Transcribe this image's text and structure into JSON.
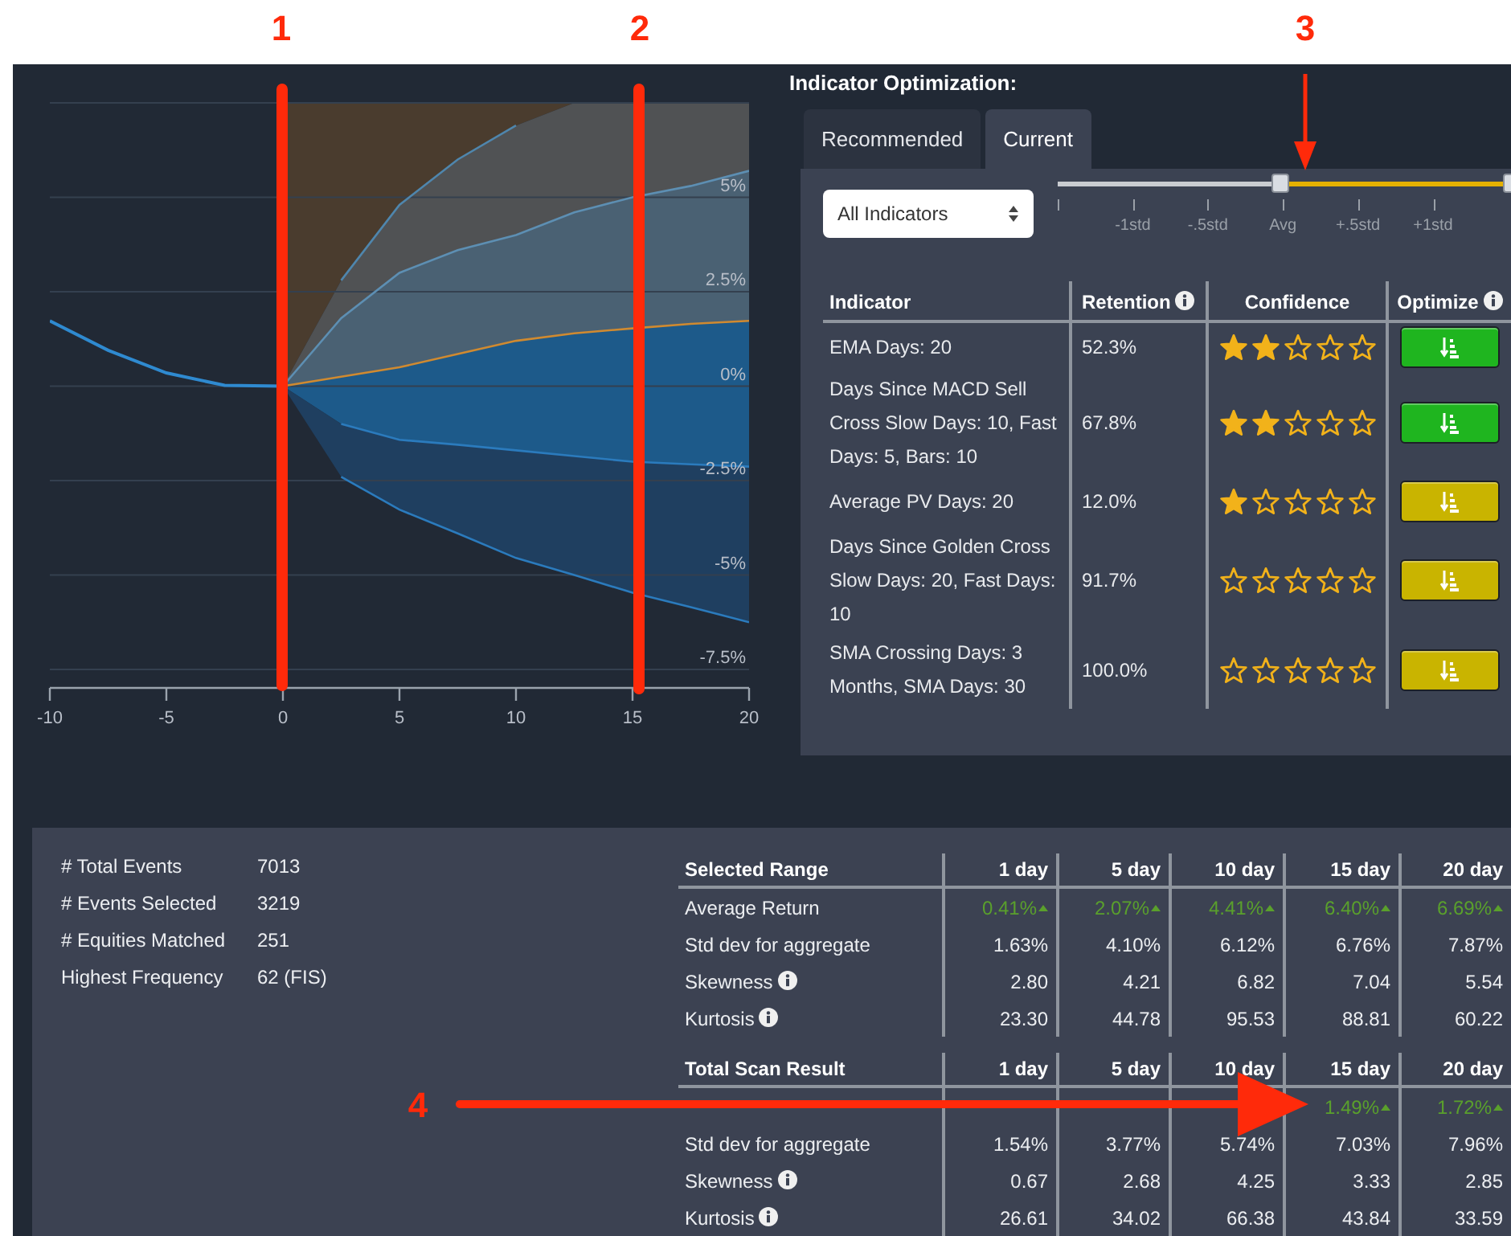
{
  "callouts": [
    {
      "label": "1",
      "kind": "vline"
    },
    {
      "label": "2",
      "kind": "vline"
    },
    {
      "label": "3",
      "kind": "down-arrow"
    },
    {
      "label": "4",
      "kind": "right-arrow"
    }
  ],
  "chart": {
    "chart_data": {
      "type": "line",
      "grid": true,
      "x": [
        -10,
        -7.5,
        -5,
        -2.5,
        0,
        2.5,
        5,
        7.5,
        10,
        12.5,
        15,
        17.5,
        20
      ],
      "xlim": [
        -10,
        20
      ],
      "ylim": [
        -7.5,
        7.5
      ],
      "xticks": [
        -10,
        -5,
        0,
        5,
        10,
        15,
        20
      ],
      "yticks": [
        {
          "value": 5,
          "label": "5%"
        },
        {
          "value": 2.5,
          "label": "2.5%"
        },
        {
          "value": 0,
          "label": "0%"
        },
        {
          "value": -2.5,
          "label": "-2.5%"
        },
        {
          "value": -5,
          "label": "-5%"
        },
        {
          "value": -7.5,
          "label": "-7.5%"
        }
      ],
      "series": [
        {
          "color": "#2f8ad0",
          "values": [
            1.73,
            0.95,
            0.35,
            0.02,
            0,
            null,
            null,
            null,
            null,
            null,
            null,
            null,
            null
          ]
        },
        {
          "color": "#4f86ad",
          "values": [
            null,
            null,
            null,
            null,
            null,
            2.8,
            4.8,
            6.0,
            6.9,
            null,
            null,
            null,
            null
          ]
        },
        {
          "color": "#5d8fb3",
          "values": [
            null,
            null,
            null,
            null,
            0,
            1.8,
            3.0,
            3.6,
            4.0,
            4.6,
            5.0,
            5.3,
            5.7
          ]
        },
        {
          "color": "#d08a30",
          "values": [
            null,
            null,
            null,
            null,
            0,
            0.25,
            0.5,
            0.85,
            1.2,
            1.4,
            1.53,
            1.65,
            1.73
          ]
        },
        {
          "color": "#2b7bbd",
          "values": [
            null,
            null,
            null,
            null,
            null,
            -1.0,
            -1.42,
            -1.55,
            -1.7,
            -1.85,
            -2.0,
            -2.07,
            -2.13
          ]
        },
        {
          "color": "#2b7bbd",
          "values": [
            null,
            null,
            null,
            null,
            null,
            -2.4,
            -3.27,
            -3.9,
            -4.55,
            -5.0,
            -5.47,
            -5.85,
            -6.25
          ]
        }
      ]
    }
  },
  "optimization": {
    "title": "Indicator Optimization:",
    "tabs": [
      {
        "label": "Recommended",
        "selected": false
      },
      {
        "label": "Current",
        "selected": true
      }
    ],
    "filter": {
      "value": "All Indicators"
    },
    "slider": {
      "ticks": [
        "-1std",
        "-.5std",
        "Avg",
        "+.5std",
        "+1std"
      ],
      "thumbs": [
        {
          "level": 0.49
        },
        {
          "level": 1
        }
      ]
    },
    "table": {
      "columns": [
        {
          "label": "Indicator",
          "info": false
        },
        {
          "label": "Retention",
          "info": true
        },
        {
          "label": "Confidence",
          "info": false
        },
        {
          "label": "Optimize",
          "info": true
        }
      ],
      "rows": [
        {
          "indicator": "EMA Days: 20",
          "retention": "52.3%",
          "stars": 2,
          "color": "#1fb51f"
        },
        {
          "indicator": "Days Since MACD Sell Cross Slow Days: 10, Fast Days: 5, Bars: 10",
          "retention": "67.8%",
          "stars": 2,
          "color": "#1fb51f"
        },
        {
          "indicator": "Average PV Days: 20",
          "retention": "12.0%",
          "stars": 1,
          "color": "#c9b400"
        },
        {
          "indicator": "Days Since Golden Cross Slow Days: 20, Fast Days: 10",
          "retention": "91.7%",
          "stars": 0,
          "color": "#c9b400"
        },
        {
          "indicator": "SMA Crossing Days: 3 Months, SMA Days: 30",
          "retention": "100.0%",
          "stars": 0,
          "color": "#c9b400"
        }
      ]
    }
  },
  "summary": [
    {
      "label": "# Total Events",
      "value": "7013"
    },
    {
      "label": "# Events Selected",
      "value": "3219"
    },
    {
      "label": "# Equities Matched",
      "value": "251"
    },
    {
      "label": "Highest Frequency",
      "value": "62 (FIS)"
    }
  ],
  "tables": [
    {
      "title": "Selected Range",
      "columns": [
        "1 day",
        "5 day",
        "10 day",
        "15 day",
        "20 day"
      ],
      "rows": [
        {
          "label": "Average Return",
          "info": false,
          "cells": [
            {
              "value": "0.41%",
              "rising": true
            },
            {
              "value": "2.07%",
              "rising": true
            },
            {
              "value": "4.41%",
              "rising": true
            },
            {
              "value": "6.40%",
              "rising": true
            },
            {
              "value": "6.69%",
              "rising": true
            }
          ]
        },
        {
          "label": "Std dev for aggregate",
          "info": false,
          "cells": [
            {
              "value": "1.63%"
            },
            {
              "value": "4.10%"
            },
            {
              "value": "6.12%"
            },
            {
              "value": "6.76%"
            },
            {
              "value": "7.87%"
            }
          ]
        },
        {
          "label": "Skewness",
          "info": true,
          "cells": [
            {
              "value": "2.80"
            },
            {
              "value": "4.21"
            },
            {
              "value": "6.82"
            },
            {
              "value": "7.04"
            },
            {
              "value": "5.54"
            }
          ]
        },
        {
          "label": "Kurtosis",
          "info": true,
          "cells": [
            {
              "value": "23.30"
            },
            {
              "value": "44.78"
            },
            {
              "value": "95.53"
            },
            {
              "value": "88.81"
            },
            {
              "value": "60.22"
            }
          ]
        }
      ]
    },
    {
      "title": "Total Scan Result",
      "columns": [
        "1 day",
        "5 day",
        "10 day",
        "15 day",
        "20 day"
      ],
      "rows": [
        {
          "info": false,
          "cells": [
            null,
            null,
            null,
            {
              "value": "1.49%",
              "rising": true
            },
            {
              "value": "1.72%",
              "rising": true
            }
          ]
        },
        {
          "label": "Std dev for aggregate",
          "info": false,
          "cells": [
            {
              "value": "1.54%"
            },
            {
              "value": "3.77%"
            },
            {
              "value": "5.74%"
            },
            {
              "value": "7.03%"
            },
            {
              "value": "7.96%"
            }
          ]
        },
        {
          "label": "Skewness",
          "info": true,
          "cells": [
            {
              "value": "0.67"
            },
            {
              "value": "2.68"
            },
            {
              "value": "4.25"
            },
            {
              "value": "3.33"
            },
            {
              "value": "2.85"
            }
          ]
        },
        {
          "label": "Kurtosis",
          "info": true,
          "cells": [
            {
              "value": "26.61"
            },
            {
              "value": "34.02"
            },
            {
              "value": "66.38"
            },
            {
              "value": "43.84"
            },
            {
              "value": "33.59"
            }
          ]
        }
      ]
    }
  ]
}
